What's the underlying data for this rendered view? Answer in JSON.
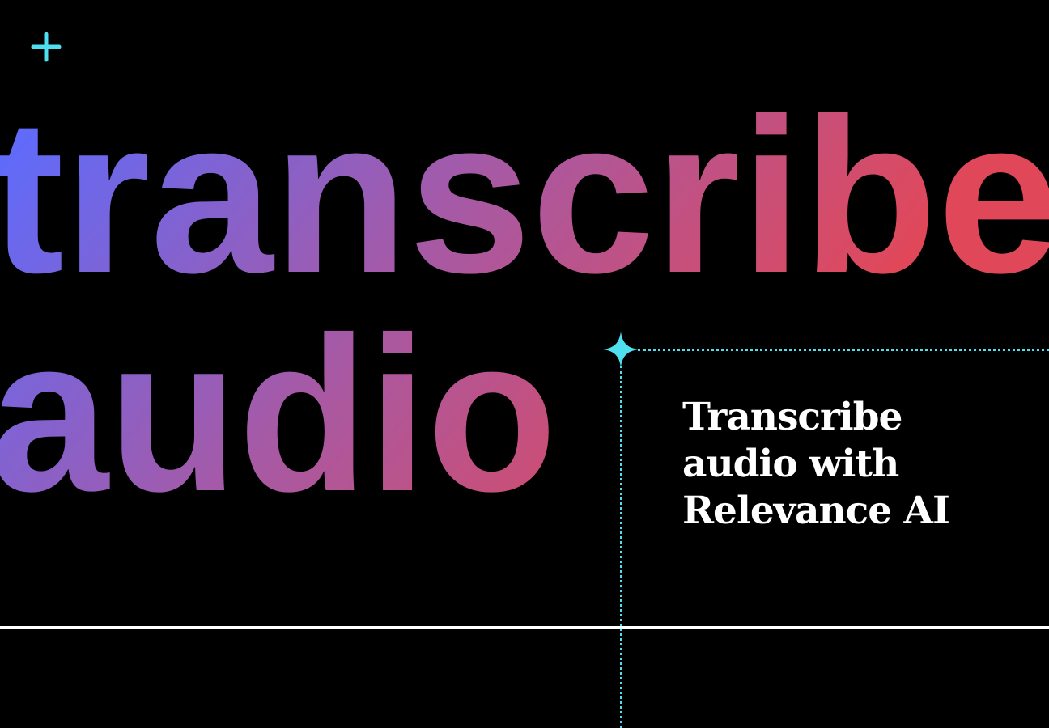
{
  "headline": {
    "line1": "transcribe",
    "line2": "audio"
  },
  "caption": {
    "line1": "Transcribe",
    "line2": "audio with",
    "line3": "Relevance AI"
  },
  "icons": {
    "top_left": "plus-icon",
    "corner": "sparkle-icon"
  },
  "colors": {
    "background": "#000000",
    "gradient_start": "#5b6cff",
    "gradient_mid": "#a45aa8",
    "gradient_end": "#e0485a",
    "accent_cyan": "#4fe0f0",
    "text": "#ffffff"
  }
}
